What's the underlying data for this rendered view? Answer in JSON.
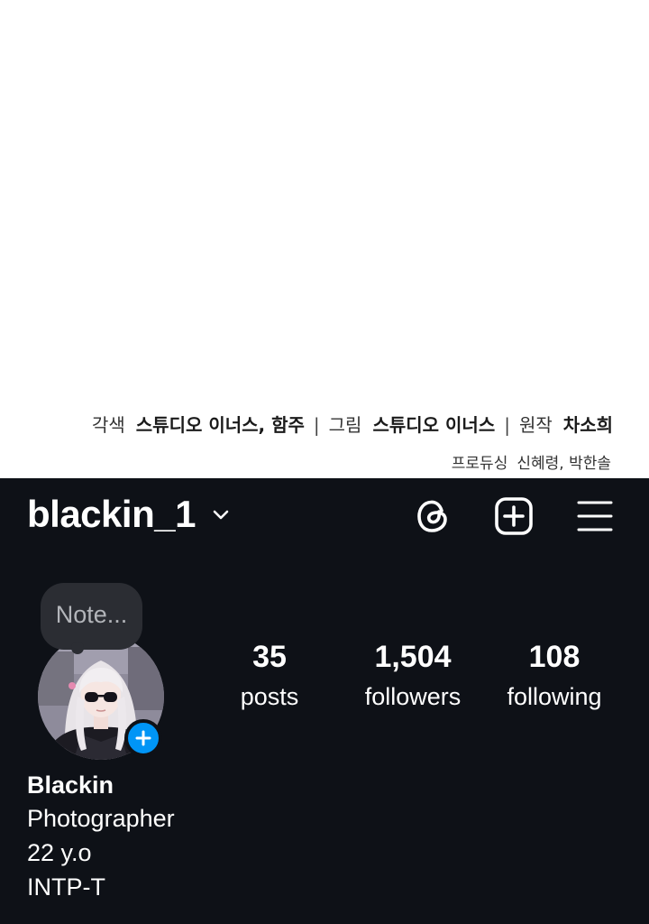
{
  "credits": {
    "line1": [
      {
        "label": "각색",
        "value": "스튜디오 이너스, 함주"
      },
      {
        "label": "그림",
        "value": "스튜디오 이너스"
      },
      {
        "label": "원작",
        "value": "차소희"
      }
    ],
    "line2": {
      "label": "프로듀싱",
      "value": "신혜령, 박한솔"
    },
    "separator": "|"
  },
  "profile": {
    "username": "blackin_1",
    "note": "Note...",
    "stats": {
      "posts": {
        "count": "35",
        "label": "posts"
      },
      "followers": {
        "count": "1,504",
        "label": "followers"
      },
      "following": {
        "count": "108",
        "label": "following"
      }
    },
    "bio": {
      "name": "Blackin",
      "lines": [
        "Photographer",
        "22 y.o",
        "INTP-T"
      ]
    }
  },
  "icons": {
    "switch": "chevron-down-icon",
    "threads": "threads-icon",
    "create": "plus-square-icon",
    "menu": "hamburger-menu-icon",
    "add_story": "plus-circle-icon"
  },
  "colors": {
    "panel_bg": "#0e1117",
    "note_bg": "#2b2d33",
    "accent": "#0095f6",
    "text": "#ffffff"
  }
}
